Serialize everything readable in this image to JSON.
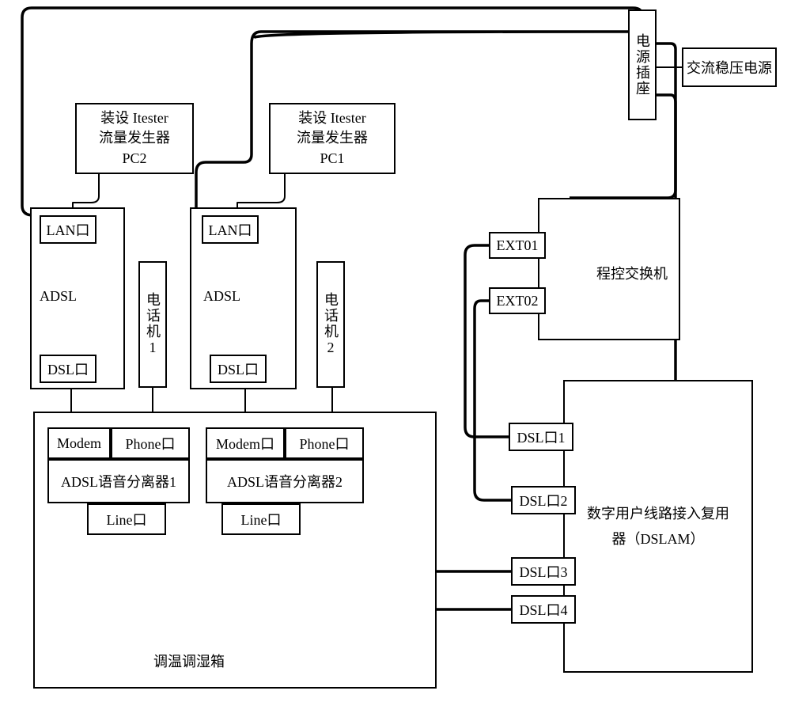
{
  "power_socket": "电源插座",
  "ac_power": "交流稳压电源",
  "pc2": "装设 Itester\n流量发生器\nPC2",
  "pc1": "装设 Itester\n流量发生器\nPC1",
  "lan_port": "LAN口",
  "adsl": "ADSL",
  "dsl_port": "DSL口",
  "phone1": "电话机1",
  "phone2": "电话机2",
  "pbx": "程控交换机",
  "ext01": "EXT01",
  "ext02": "EXT02",
  "modem": "Modem",
  "modem_port": "Modem口",
  "phone_port": "Phone口",
  "splitter1": "ADSL语音分离器1",
  "splitter2": "ADSL语音分离器2",
  "line_port": "Line口",
  "dsl1": "DSL口1",
  "dsl2": "DSL口2",
  "dsl3": "DSL口3",
  "dsl4": "DSL口4",
  "dslam": "数字用户线路接入复用器（DSLAM）",
  "chamber": "调温调湿箱",
  "chart_data": {
    "type": "diagram",
    "nodes": [
      {
        "id": "ac_power",
        "label": "交流稳压电源"
      },
      {
        "id": "power_socket",
        "label": "电源插座"
      },
      {
        "id": "pbx",
        "label": "程控交换机",
        "ports": [
          "EXT01",
          "EXT02"
        ]
      },
      {
        "id": "dslam",
        "label": "数字用户线路接入复用器（DSLAM）",
        "ports": [
          "DSL口1",
          "DSL口2",
          "DSL口3",
          "DSL口4"
        ]
      },
      {
        "id": "pc1",
        "label": "装设 Itester 流量发生器 PC1"
      },
      {
        "id": "pc2",
        "label": "装设 Itester 流量发生器 PC2"
      },
      {
        "id": "adsl1",
        "label": "ADSL",
        "ports": [
          "LAN口",
          "DSL口"
        ]
      },
      {
        "id": "adsl2",
        "label": "ADSL",
        "ports": [
          "LAN口",
          "DSL口"
        ]
      },
      {
        "id": "phone1",
        "label": "电话机1"
      },
      {
        "id": "phone2",
        "label": "电话机2"
      },
      {
        "id": "splitter1",
        "label": "ADSL语音分离器1",
        "ports": [
          "Modem",
          "Phone口",
          "Line口"
        ]
      },
      {
        "id": "splitter2",
        "label": "ADSL语音分离器2",
        "ports": [
          "Modem口",
          "Phone口",
          "Line口"
        ]
      },
      {
        "id": "chamber",
        "label": "调温调湿箱"
      }
    ],
    "edges": [
      {
        "from": "ac_power",
        "to": "power_socket"
      },
      {
        "from": "power_socket",
        "to": "adsl1"
      },
      {
        "from": "power_socket",
        "to": "pbx"
      },
      {
        "from": "power_socket",
        "to": "dslam"
      },
      {
        "from": "pc2",
        "to": "adsl1.LAN口"
      },
      {
        "from": "pc1",
        "to": "adsl2.LAN口"
      },
      {
        "from": "adsl1.DSL口",
        "to": "splitter1.Modem"
      },
      {
        "from": "adsl2.DSL口",
        "to": "splitter2.Modem口"
      },
      {
        "from": "phone1",
        "to": "splitter1.Phone口"
      },
      {
        "from": "phone2",
        "to": "splitter2.Phone口"
      },
      {
        "from": "splitter1.Line口",
        "to": "dslam.DSL口4"
      },
      {
        "from": "splitter2.Line口",
        "to": "dslam.DSL口3"
      },
      {
        "from": "pbx.EXT01",
        "to": "dslam.DSL口1"
      },
      {
        "from": "pbx.EXT02",
        "to": "dslam.DSL口2"
      },
      {
        "from": "adsl2",
        "to": "power_socket"
      }
    ]
  }
}
